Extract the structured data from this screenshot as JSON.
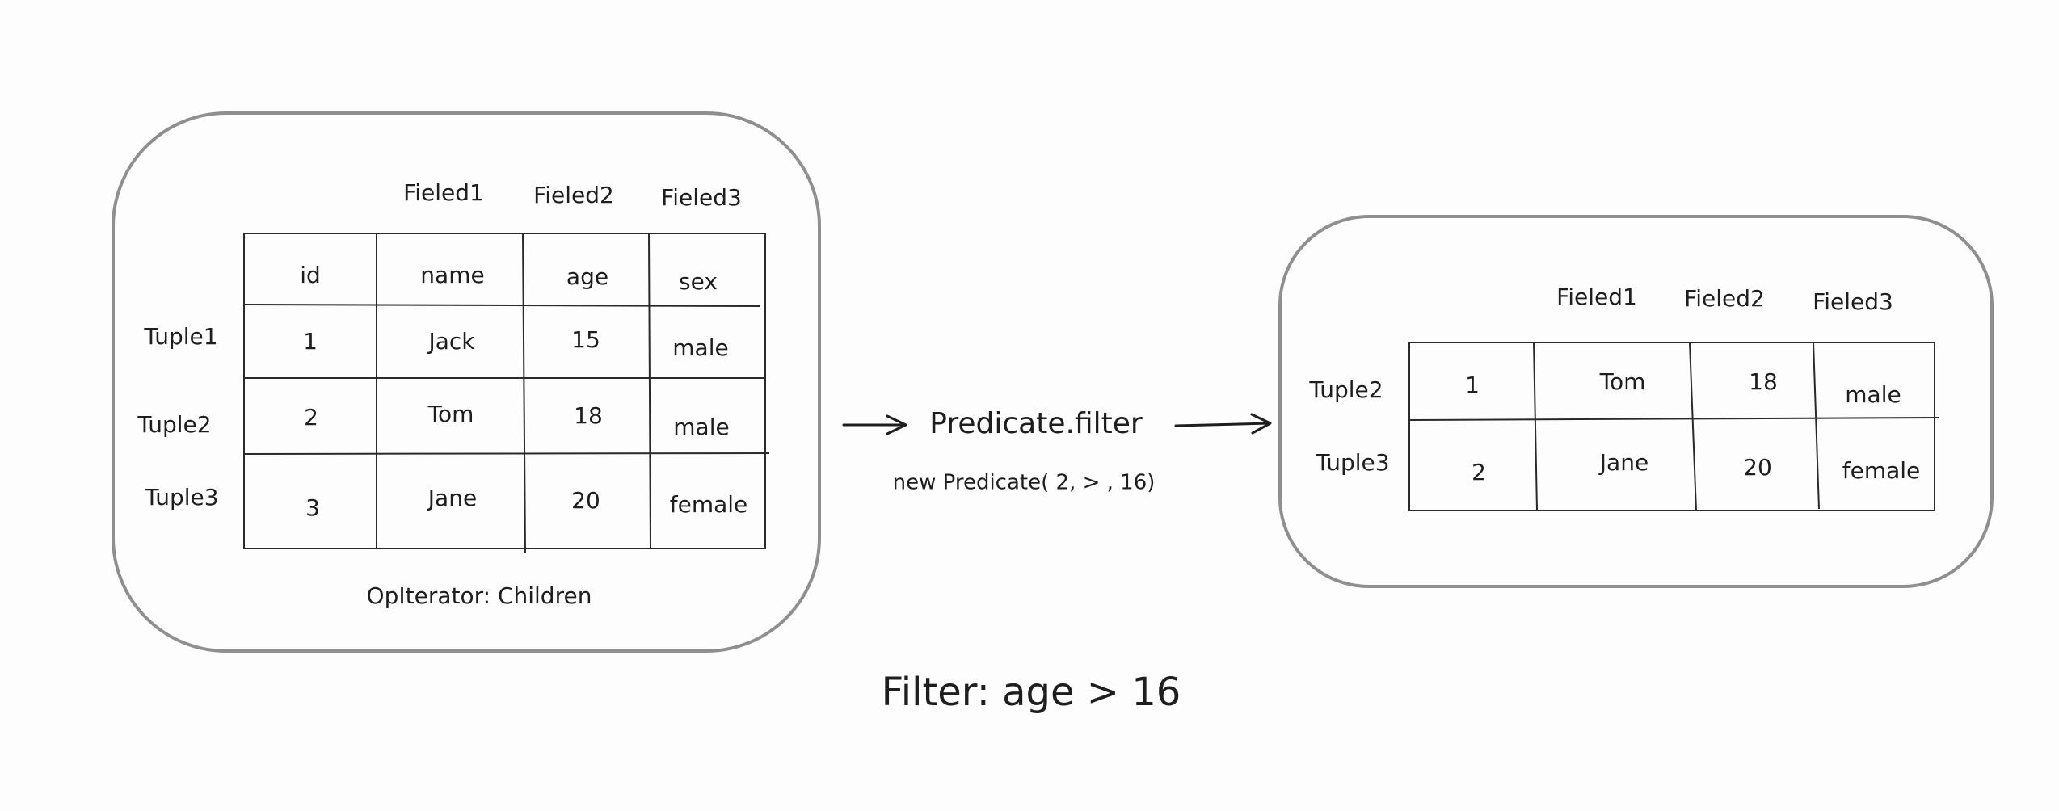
{
  "colors": {
    "input_fill": "#fcd6b6",
    "input_hatch": "#f5a36a",
    "output_fill": "#b0eedb",
    "output_hatch": "#3cc39b",
    "container_stroke": "#8f8f8f",
    "ink": "#1e1e1e"
  },
  "input": {
    "field_labels": [
      "Fieled1",
      "Fieled2",
      "Fieled3"
    ],
    "header": [
      "id",
      "name",
      "age",
      "sex"
    ],
    "tuple_labels": [
      "Tuple1",
      "Tuple2",
      "Tuple3"
    ],
    "rows": [
      [
        "1",
        "Jack",
        "15",
        "male"
      ],
      [
        "2",
        "Tom",
        "18",
        "male"
      ],
      [
        "3",
        "Jane",
        "20",
        "female"
      ]
    ],
    "caption": "OpIterator: Children"
  },
  "operator": {
    "name": "Predicate.filter",
    "code": "new Predicate( 2, > , 16)"
  },
  "output": {
    "field_labels": [
      "Fieled1",
      "Fieled2",
      "Fieled3"
    ],
    "tuple_labels": [
      "Tuple2",
      "Tuple3"
    ],
    "rows": [
      [
        "1",
        "Tom",
        "18",
        "male"
      ],
      [
        "2",
        "Jane",
        "20",
        "female"
      ]
    ]
  },
  "title": "Filter: age > 16"
}
